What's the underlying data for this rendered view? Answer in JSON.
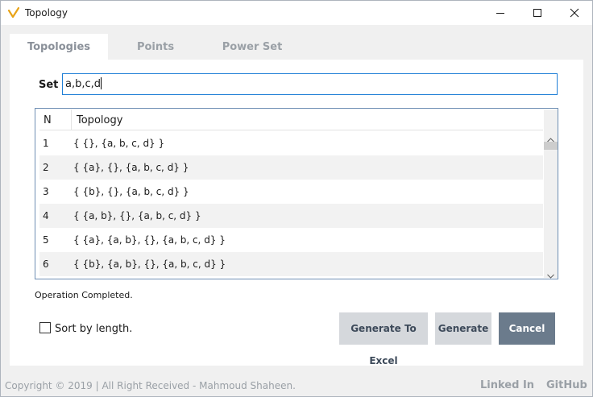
{
  "window": {
    "title": "Topology",
    "icon": "topology-app-icon"
  },
  "tabs": [
    {
      "label": "Topologies",
      "active": true
    },
    {
      "label": "Points",
      "active": false
    },
    {
      "label": "Power Set",
      "active": false
    }
  ],
  "set": {
    "label": "Set",
    "value": "a,b,c,d"
  },
  "grid": {
    "columns": [
      "N",
      "Topology"
    ],
    "rows": [
      {
        "n": "1",
        "topology": "{ {}, {a, b, c, d} }"
      },
      {
        "n": "2",
        "topology": "{ {a}, {}, {a, b, c, d} }"
      },
      {
        "n": "3",
        "topology": "{ {b}, {}, {a, b, c, d} }"
      },
      {
        "n": "4",
        "topology": "{ {a, b}, {}, {a, b, c, d} }"
      },
      {
        "n": "5",
        "topology": "{ {a}, {a, b}, {}, {a, b, c, d} }"
      },
      {
        "n": "6",
        "topology": "{ {b}, {a, b}, {}, {a, b, c, d} }"
      }
    ]
  },
  "status": "Operation Completed.",
  "options": {
    "sort_label": "Sort by length.",
    "sort_checked": false
  },
  "buttons": {
    "excel": "Generate To Excel",
    "generate": "Generate",
    "cancel": "Cancel"
  },
  "footer": {
    "copyright": "Copyright © 2019 | All Right Received - Mahmoud Shaheen.",
    "linkedin": "Linked In",
    "github": "GitHub"
  },
  "colors": {
    "accent": "#1f7fd6",
    "cancel_bg": "#6b7b8c",
    "button_bg": "#d5d8dc",
    "muted_text": "#9aa0a6"
  }
}
